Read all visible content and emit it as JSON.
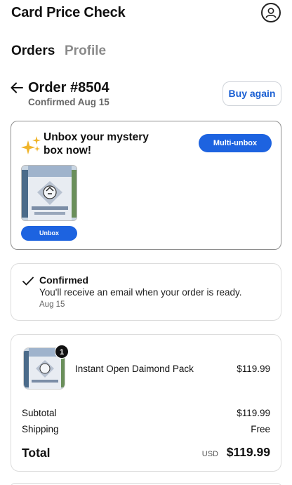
{
  "app": {
    "title": "Card Price Check"
  },
  "tabs": [
    {
      "label": "Orders",
      "active": true
    },
    {
      "label": "Profile",
      "active": false
    }
  ],
  "order": {
    "title": "Order #8504",
    "subtitle": "Confirmed Aug 15",
    "buy_again_label": "Buy again"
  },
  "unbox": {
    "title": "Unbox your mystery box now!",
    "multi_button_label": "Multi-unbox",
    "unbox_button_label": "Unbox",
    "sparkle_color": "#f0b429"
  },
  "status": {
    "title": "Confirmed",
    "message": "You'll receive an email when your order is ready.",
    "date": "Aug 15"
  },
  "summary": {
    "item": {
      "name": "Instant Open Daimond Pack",
      "price": "$119.99",
      "quantity": "1"
    },
    "subtotal_label": "Subtotal",
    "subtotal_value": "$119.99",
    "shipping_label": "Shipping",
    "shipping_value": "Free",
    "total_label": "Total",
    "currency": "USD",
    "total_value": "$119.99"
  },
  "colors": {
    "accent": "#1d63e0",
    "link": "#1a5fd3"
  }
}
